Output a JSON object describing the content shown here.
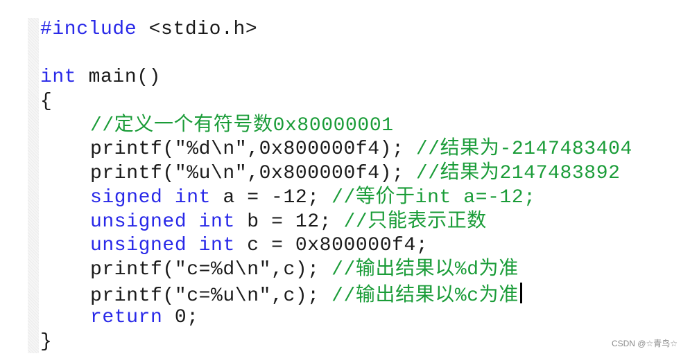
{
  "editor": {
    "lines": [
      {
        "tokens": [
          {
            "type": "pp",
            "text": "#include"
          },
          {
            "type": "tx",
            "text": " <stdio.h>"
          }
        ]
      },
      {
        "tokens": []
      },
      {
        "tokens": [
          {
            "type": "kw",
            "text": "int"
          },
          {
            "type": "tx",
            "text": " main()"
          }
        ]
      },
      {
        "tokens": [
          {
            "type": "tx",
            "text": "{"
          }
        ]
      },
      {
        "indent": true,
        "tokens": [
          {
            "type": "cm",
            "text": "//定义一个有符号数0x80000001"
          }
        ]
      },
      {
        "indent": true,
        "tokens": [
          {
            "type": "tx",
            "text": "printf(\"%d\\n\",0x800000f4); "
          },
          {
            "type": "cm",
            "text": "//结果为-2147483404"
          }
        ]
      },
      {
        "indent": true,
        "tokens": [
          {
            "type": "tx",
            "text": "printf(\"%u\\n\",0x800000f4); "
          },
          {
            "type": "cm",
            "text": "//结果为2147483892"
          }
        ]
      },
      {
        "indent": true,
        "tokens": [
          {
            "type": "kw",
            "text": "signed"
          },
          {
            "type": "tx",
            "text": " "
          },
          {
            "type": "kw",
            "text": "int"
          },
          {
            "type": "tx",
            "text": " a = -12; "
          },
          {
            "type": "cm",
            "text": "//等价于int a=-12;"
          }
        ]
      },
      {
        "indent": true,
        "tokens": [
          {
            "type": "kw",
            "text": "unsigned"
          },
          {
            "type": "tx",
            "text": " "
          },
          {
            "type": "kw",
            "text": "int"
          },
          {
            "type": "tx",
            "text": " b = 12; "
          },
          {
            "type": "cm",
            "text": "//只能表示正数"
          }
        ]
      },
      {
        "indent": true,
        "tokens": [
          {
            "type": "kw",
            "text": "unsigned"
          },
          {
            "type": "tx",
            "text": " "
          },
          {
            "type": "kw",
            "text": "int"
          },
          {
            "type": "tx",
            "text": " c = 0x800000f4;"
          }
        ]
      },
      {
        "indent": true,
        "tokens": [
          {
            "type": "tx",
            "text": "printf(\"c=%d\\n\",c); "
          },
          {
            "type": "cm",
            "text": "//输出结果以%d为准"
          }
        ]
      },
      {
        "indent": true,
        "cursor": true,
        "tokens": [
          {
            "type": "tx",
            "text": "printf(\"c=%u\\n\",c); "
          },
          {
            "type": "cm",
            "text": "//输出结果以%c为准"
          }
        ]
      },
      {
        "indent": true,
        "tokens": [
          {
            "type": "kw",
            "text": "return"
          },
          {
            "type": "tx",
            "text": " 0;"
          }
        ]
      },
      {
        "tokens": [
          {
            "type": "tx",
            "text": "}"
          }
        ]
      }
    ]
  },
  "watermark": "CSDN @☆青鸟☆"
}
